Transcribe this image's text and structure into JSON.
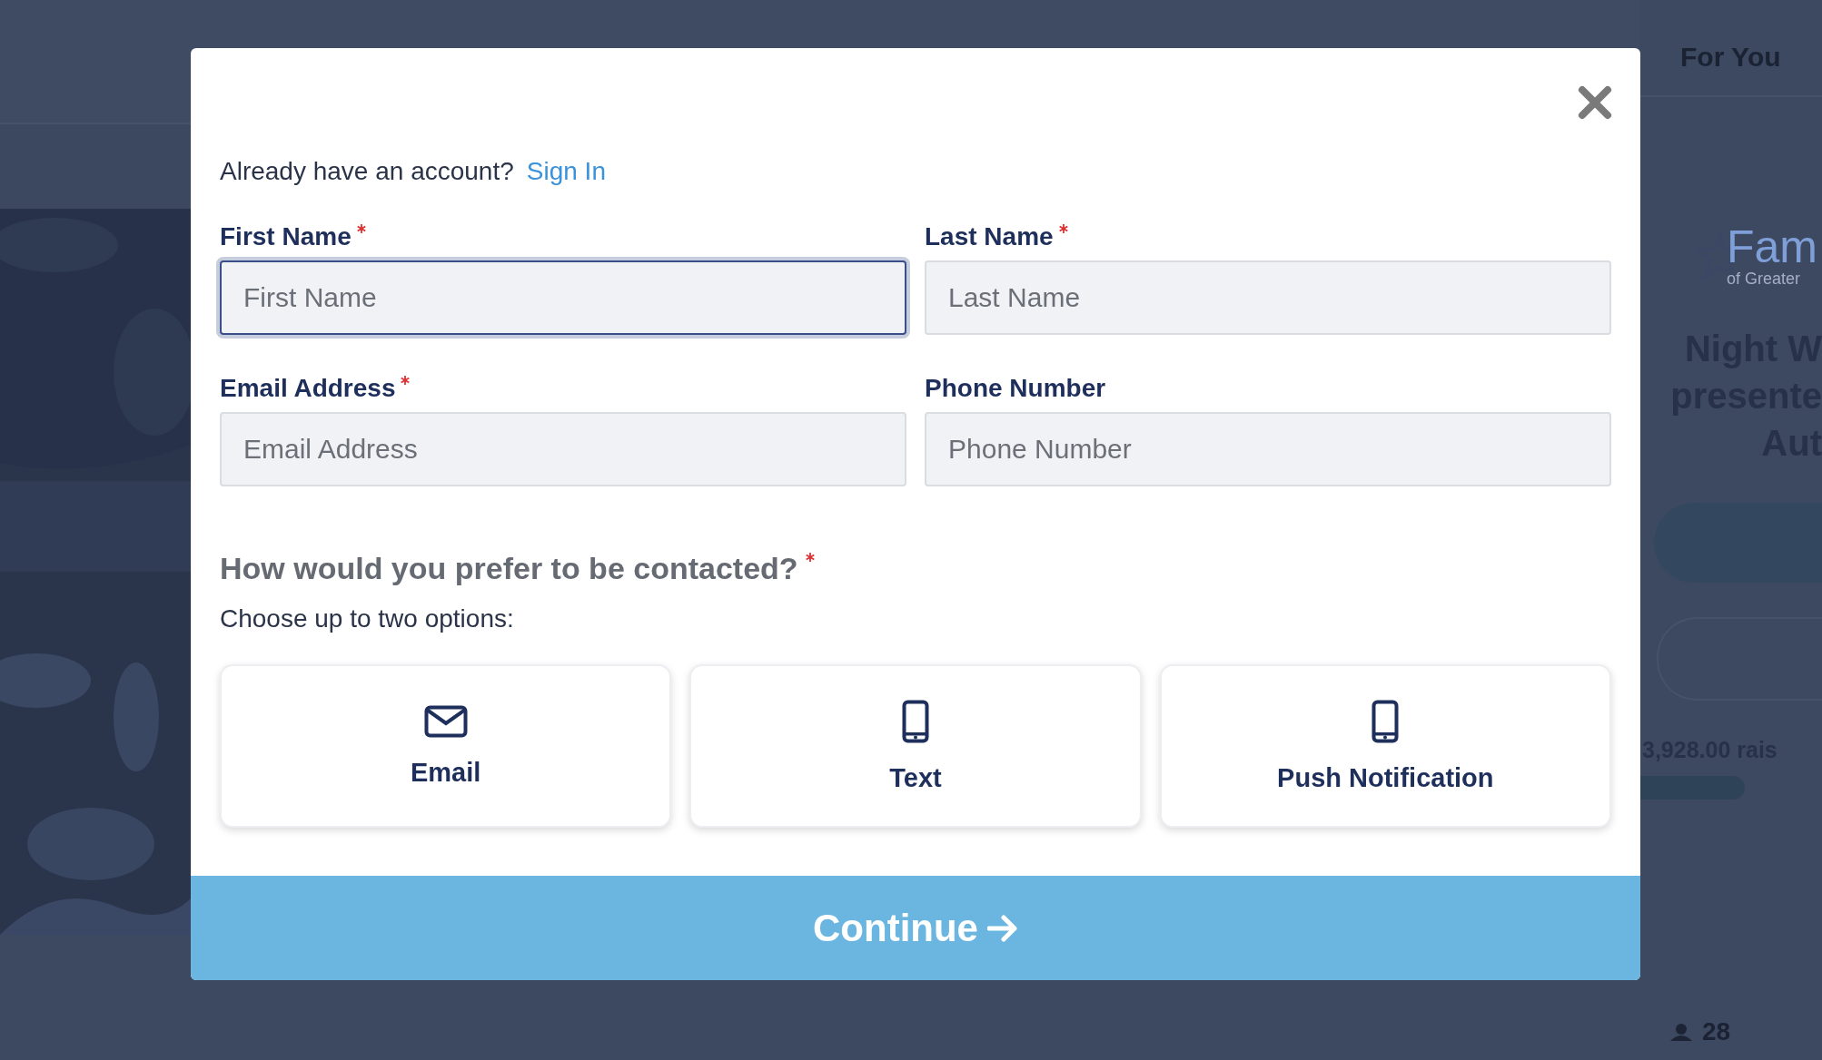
{
  "background": {
    "nav_link": "For You",
    "logo_text": "Fam",
    "logo_subtext": "of Greater",
    "title_lines": [
      "Night W",
      "presente",
      "Aut"
    ],
    "raised": "3,928.00 rais",
    "count": "28"
  },
  "modal": {
    "prompt": "Already have an account?",
    "sign_in": "Sign In",
    "fields": [
      {
        "label": "First Name",
        "placeholder": "First Name",
        "required": true,
        "focused": true
      },
      {
        "label": "Last Name",
        "placeholder": "Last Name",
        "required": true,
        "focused": false
      },
      {
        "label": "Email Address",
        "placeholder": "Email Address",
        "required": true,
        "focused": false
      },
      {
        "label": "Phone Number",
        "placeholder": "Phone Number",
        "required": false,
        "focused": false
      }
    ],
    "question": "How would you prefer to be contacted?",
    "question_required": true,
    "hint": "Choose up to two options:",
    "options": [
      {
        "kind": "envelope",
        "label": "Email",
        "selected": false
      },
      {
        "kind": "phone",
        "label": "Text",
        "selected": false
      },
      {
        "kind": "phone",
        "label": "Push Notification",
        "selected": false
      }
    ],
    "continue": "Continue"
  }
}
